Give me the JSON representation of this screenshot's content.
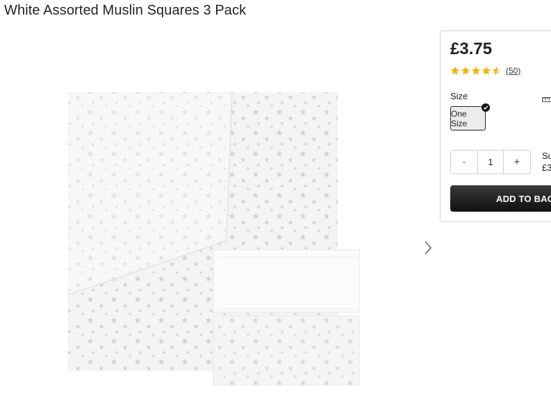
{
  "product": {
    "title": "White Assorted Muslin Squares 3 Pack",
    "image_alt": "White assorted muslin squares with star print"
  },
  "buy_panel": {
    "price": "£3.75",
    "rating": {
      "stars": 4.5,
      "max_stars": 5,
      "count_label": "(50)"
    },
    "size_label": "Size",
    "size_options": [
      "One Size"
    ],
    "selected_size": "One Size",
    "quantity": "1",
    "qty_minus": "-",
    "qty_plus": "+",
    "subtotal_label": "Su",
    "subtotal_value": "£3",
    "add_to_bag": "ADD TO BAG"
  },
  "colors": {
    "star_fill": "#f5b300",
    "button_bg": "#1a1a1a",
    "panel_border": "#d5d5d5"
  },
  "icons": {
    "next": "chevron-right-icon",
    "size_guide": "ruler-icon",
    "selected": "check-icon",
    "rating": "star-icon"
  }
}
